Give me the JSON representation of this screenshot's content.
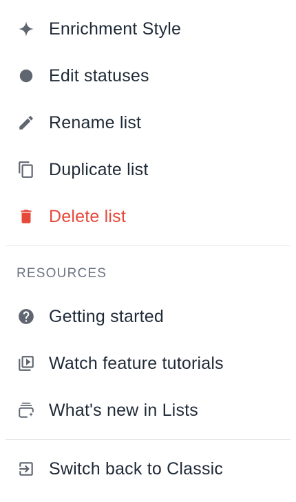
{
  "menu": {
    "items": [
      {
        "label": "Enrichment Style",
        "icon": "sparkle-icon"
      },
      {
        "label": "Edit statuses",
        "icon": "circle-dot-icon"
      },
      {
        "label": "Rename list",
        "icon": "pencil-icon"
      },
      {
        "label": "Duplicate list",
        "icon": "copy-icon"
      },
      {
        "label": "Delete list",
        "icon": "trash-icon",
        "color": "#e5493a"
      }
    ],
    "resources": {
      "header": "RESOURCES",
      "items": [
        {
          "label": "Getting started",
          "icon": "help-circle-icon"
        },
        {
          "label": "Watch feature tutorials",
          "icon": "video-library-icon"
        },
        {
          "label": "What's new in Lists",
          "icon": "stack-sparkle-icon"
        }
      ]
    },
    "footer": {
      "label": "Switch back to Classic",
      "icon": "exit-to-app-icon"
    }
  },
  "colors": {
    "text": "#1f2a37",
    "icon": "#5f6670",
    "danger": "#e5493a",
    "muted": "#6b7280",
    "divider": "#e3e6ea"
  }
}
